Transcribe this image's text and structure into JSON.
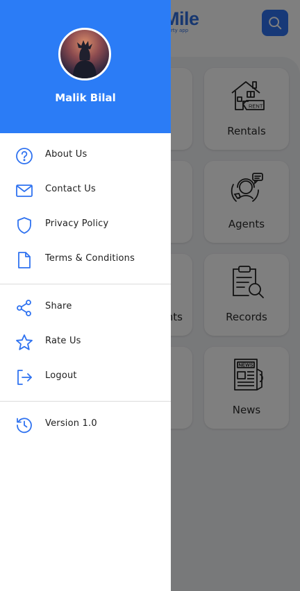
{
  "app": {
    "logo_text": "Mile",
    "logo_subtitle": "rty app",
    "search_icon": "search-icon",
    "tiles": [
      {
        "label": "Rentals",
        "icon": "rent-house-icon"
      },
      {
        "label": "Agents",
        "icon": "agent-support-icon"
      },
      {
        "label": "Records",
        "icon": "clipboard-search-icon"
      },
      {
        "label": "News",
        "icon": "newspaper-icon"
      }
    ],
    "left_tiles": [
      {
        "label": ""
      },
      {
        "label": ""
      },
      {
        "label": "nts"
      },
      {
        "label": ""
      }
    ]
  },
  "drawer": {
    "user_name": "Malik Bilal",
    "menu": [
      {
        "label": "About Us",
        "icon": "help-circle-icon"
      },
      {
        "label": "Contact Us",
        "icon": "mail-icon"
      },
      {
        "label": "Privacy Policy",
        "icon": "shield-icon"
      },
      {
        "label": "Terms & Conditions",
        "icon": "document-icon"
      },
      {
        "label": "Share",
        "icon": "share-icon"
      },
      {
        "label": "Rate Us",
        "icon": "star-icon"
      },
      {
        "label": "Logout",
        "icon": "logout-icon"
      },
      {
        "label": "Version 1.0",
        "icon": "history-icon"
      }
    ]
  },
  "colors": {
    "drawer_header": "#2b7cf6",
    "accent": "#2f72f0",
    "icon": "#2f72f0",
    "overlay": "rgba(0,0,0,0.5)"
  }
}
